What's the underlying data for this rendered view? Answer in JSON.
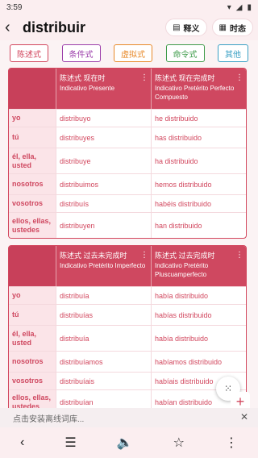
{
  "status": {
    "time": "3:59",
    "icons": [
      "wifi-icon",
      "signal-icon",
      "battery-icon"
    ]
  },
  "header": {
    "title": "distribuir",
    "btn_define": "释义",
    "btn_tense": "时态"
  },
  "tenses": [
    "陈述式",
    "条件式",
    "虚拟式",
    "命令式",
    "其他"
  ],
  "cards": [
    {
      "col1_cn": "陈述式 现在时",
      "col1_en": "Indicativo Presente",
      "col2_cn": "陈述式 现在完成时",
      "col2_en": "Indicativo Pretérito Perfecto Compuesto",
      "rows": [
        {
          "p": "yo",
          "a": "distribuyo",
          "b": "he distribuido"
        },
        {
          "p": "tú",
          "a": "distribuyes",
          "b": "has distribuido"
        },
        {
          "p": "él, ella, usted",
          "a": "distribuye",
          "b": "ha distribuido"
        },
        {
          "p": "nosotros",
          "a": "distribuimos",
          "b": "hemos distribuido"
        },
        {
          "p": "vosotros",
          "a": "distribuís",
          "b": "habéis distribuido"
        },
        {
          "p": "ellos, ellas, ustedes",
          "a": "distribuyen",
          "b": "han distribuido"
        }
      ]
    },
    {
      "col1_cn": "陈述式 过去未完成时",
      "col1_en": "Indicativo Pretérito Imperfecto",
      "col2_cn": "陈述式 过去完成时",
      "col2_en": "Indicativo Pretérito Pluscuamperfecto",
      "rows": [
        {
          "p": "yo",
          "a": "distribuía",
          "b": "había distribuido"
        },
        {
          "p": "tú",
          "a": "distribuías",
          "b": "habías distribuido"
        },
        {
          "p": "él, ella, usted",
          "a": "distribuía",
          "b": "había distribuido"
        },
        {
          "p": "nosotros",
          "a": "distribuíamos",
          "b": "habíamos distribuido"
        },
        {
          "p": "vosotros",
          "a": "distribuíais",
          "b": "habíais distribuido"
        },
        {
          "p": "ellos, ellas, ustedes",
          "a": "distribuían",
          "b": "habían distribuido"
        }
      ]
    }
  ],
  "install": {
    "text": "点击安装离线词库..."
  },
  "nav": [
    "back-icon",
    "menu-list-icon",
    "speaker-icon",
    "star-icon",
    "more-vert-icon"
  ]
}
